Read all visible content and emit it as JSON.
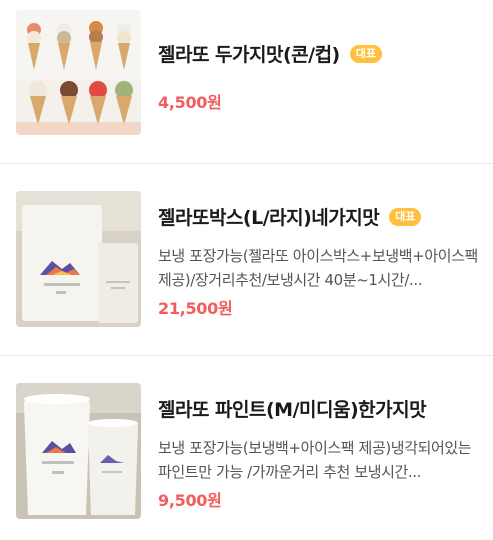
{
  "menu_items": [
    {
      "name": "젤라또 두가지맛(콘/컵)",
      "badge": "대표",
      "description": "",
      "price": "4,500원",
      "image": "gelato-cones-photo"
    },
    {
      "name": "젤라또박스(L/라지)네가지맛",
      "badge": "대표",
      "description": "보냉 포장가능(젤라또 아이스박스+보냉백+아이스팩 제공)/장거리추천/보냉시간 40분~1시간/...",
      "price": "21,500원",
      "image": "gelato-box-photo"
    },
    {
      "name": "젤라또 파인트(M/미디움)한가지맛",
      "badge": "",
      "description": "보냉 포장가능(보냉백+아이스팩 제공)냉각되어있는 파인트만 가능 /가까운거리 추천 보냉시간...",
      "price": "9,500원",
      "image": "gelato-pint-photo"
    }
  ],
  "colors": {
    "price": "#f35c5c",
    "badge_bg": "#ffbf3f",
    "divider": "#ececec"
  }
}
